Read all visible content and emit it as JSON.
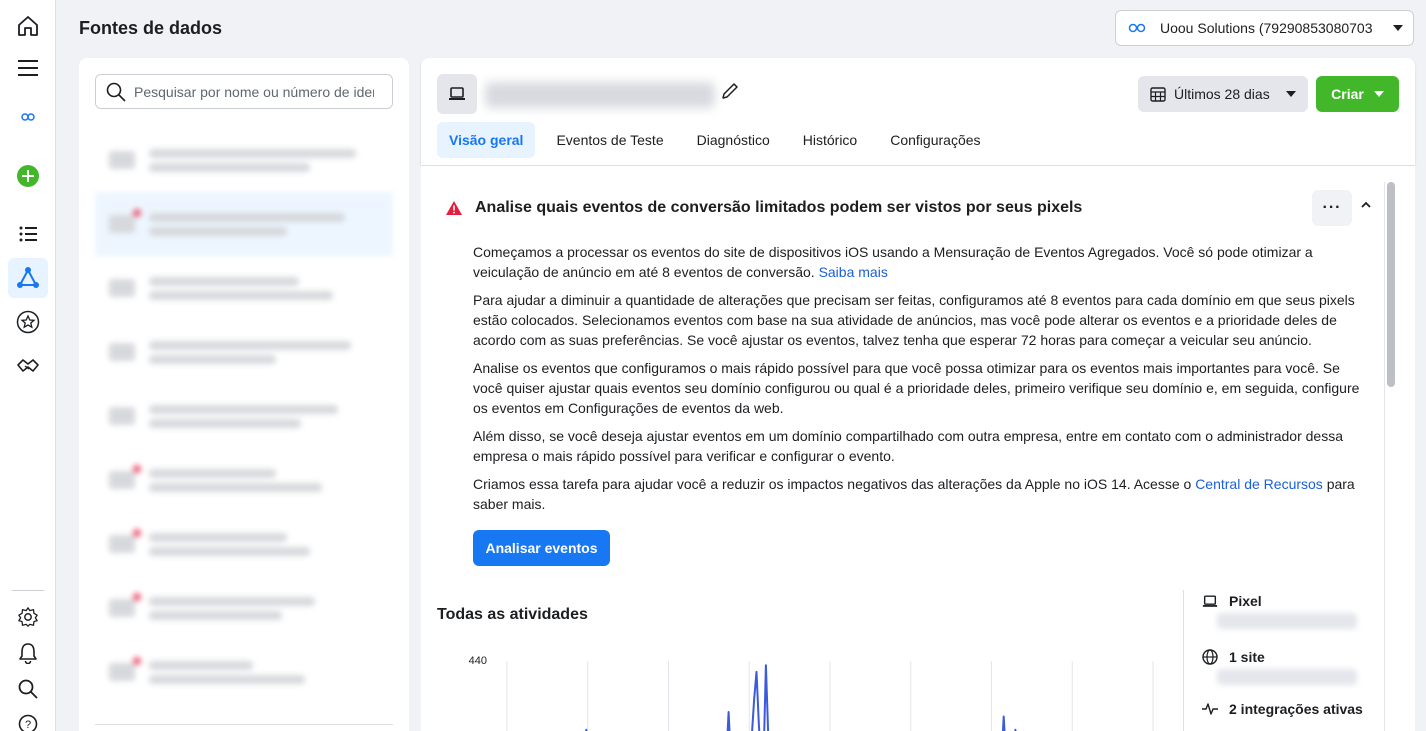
{
  "page": {
    "title": "Fontes de dados"
  },
  "account": {
    "name": "Uoou Solutions (79290853080703"
  },
  "search": {
    "placeholder": "Pesquisar por nome ou número de identificação"
  },
  "tabs": [
    {
      "label": "Visão geral"
    },
    {
      "label": "Eventos de Teste"
    },
    {
      "label": "Diagnóstico"
    },
    {
      "label": "Histórico"
    },
    {
      "label": "Configurações"
    }
  ],
  "header": {
    "date_range": "Últimos 28 dias",
    "create_label": "Criar"
  },
  "alert": {
    "title": "Analise quais eventos de conversão limitados podem ser vistos por seus pixels",
    "p1": "Começamos a processar os eventos do site de dispositivos iOS usando a Mensuração de Eventos Agregados. Você só pode otimizar a veiculação de anúncio em até 8 eventos de conversão. ",
    "p1_link": "Saiba mais",
    "p2": "Para ajudar a diminuir a quantidade de alterações que precisam ser feitas, configuramos até 8 eventos para cada domínio em que seus pixels estão colocados. Selecionamos eventos com base na sua atividade de anúncios, mas você pode alterar os eventos e a prioridade deles de acordo com as suas preferências. Se você ajustar os eventos, talvez tenha que esperar 72 horas para começar a veicular seu anúncio.",
    "p3": "Analise os eventos que configuramos o mais rápido possível para que você possa otimizar para os eventos mais importantes para você. Se você quiser ajustar quais eventos seu domínio configurou ou qual é a prioridade deles, primeiro verifique seu domínio e, em seguida, configure os eventos em Configurações de eventos da web.",
    "p4": "Além disso, se você deseja ajustar eventos em um domínio compartilhado com outra empresa, entre em contato com o administrador dessa empresa o mais rápido possível para verificar e configurar o evento.",
    "p5_before": "Criamos essa tarefa para ajudar você a reduzir os impactos negativos das alterações da Apple no iOS 14. Acesse o ",
    "p5_link": "Central de Recursos",
    "p5_after": " para saber mais.",
    "button": "Analisar eventos"
  },
  "activities": {
    "title": "Todas as atividades",
    "y_max_label": "440"
  },
  "side_info": {
    "pixel": "Pixel",
    "sites": "1 site",
    "integrations": "2 integrações ativas"
  },
  "colors": {
    "accent": "#1877f2",
    "create": "#42b72a",
    "warning": "#e41e3f",
    "line": "#3b5bdb"
  },
  "chart_data": {
    "type": "line",
    "ylim": [
      0,
      440
    ],
    "yticks": [
      440
    ],
    "values": [
      0,
      0,
      0,
      0,
      0,
      0,
      0,
      0,
      0,
      0,
      0,
      0,
      0,
      0,
      0,
      0,
      0,
      0,
      0,
      0,
      0,
      0,
      0,
      0,
      0,
      0,
      0,
      0,
      0,
      0,
      0,
      0,
      0,
      0,
      140,
      0,
      0,
      0,
      0,
      0,
      0,
      0,
      0,
      0,
      0,
      0,
      0,
      0,
      0,
      0,
      0,
      0,
      0,
      0,
      0,
      0,
      0,
      0,
      0,
      0,
      0,
      0,
      0,
      0,
      0,
      0,
      0,
      0,
      0,
      0,
      0,
      0,
      0,
      0,
      0,
      0,
      0,
      0,
      0,
      0,
      0,
      0,
      0,
      0,
      0,
      0,
      0,
      0,
      0,
      0,
      0,
      0,
      0,
      0,
      0,
      220,
      0,
      0,
      0,
      0,
      0,
      0,
      0,
      0,
      0,
      120,
      280,
      400,
      160,
      0,
      0,
      430,
      120,
      0,
      0,
      60,
      0,
      0,
      0,
      0,
      0,
      0,
      0,
      0,
      0,
      0,
      0,
      0,
      0,
      0,
      0,
      0,
      0,
      0,
      0,
      0,
      0,
      0,
      0,
      0,
      0,
      0,
      0,
      0,
      0,
      0,
      0,
      0,
      0,
      0,
      0,
      0,
      0,
      0,
      0,
      0,
      0,
      20,
      0,
      0,
      0,
      0,
      0,
      0,
      0,
      0,
      0,
      0,
      0,
      0,
      0,
      0,
      0,
      0,
      0,
      0,
      0,
      0,
      0,
      0,
      0,
      0,
      0,
      0,
      0,
      0,
      0,
      0,
      0,
      0,
      0,
      0,
      0,
      0,
      0,
      0,
      0,
      0,
      0,
      0,
      0,
      0,
      0,
      0,
      0,
      0,
      0,
      0,
      0,
      0,
      0,
      0,
      0,
      200,
      0,
      0,
      0,
      0,
      140,
      0,
      0,
      0,
      0,
      0,
      0,
      0,
      0,
      0,
      0,
      0,
      0,
      0,
      0,
      0,
      0,
      0,
      0,
      0,
      60,
      0,
      0,
      0,
      0,
      0,
      0,
      0,
      0,
      0,
      0,
      0,
      0,
      0,
      0,
      0,
      0,
      0,
      0,
      0,
      0,
      0,
      0,
      0,
      0,
      0,
      0,
      0,
      0,
      0,
      0,
      0,
      0,
      0,
      0,
      0,
      0,
      0,
      0,
      0
    ]
  }
}
